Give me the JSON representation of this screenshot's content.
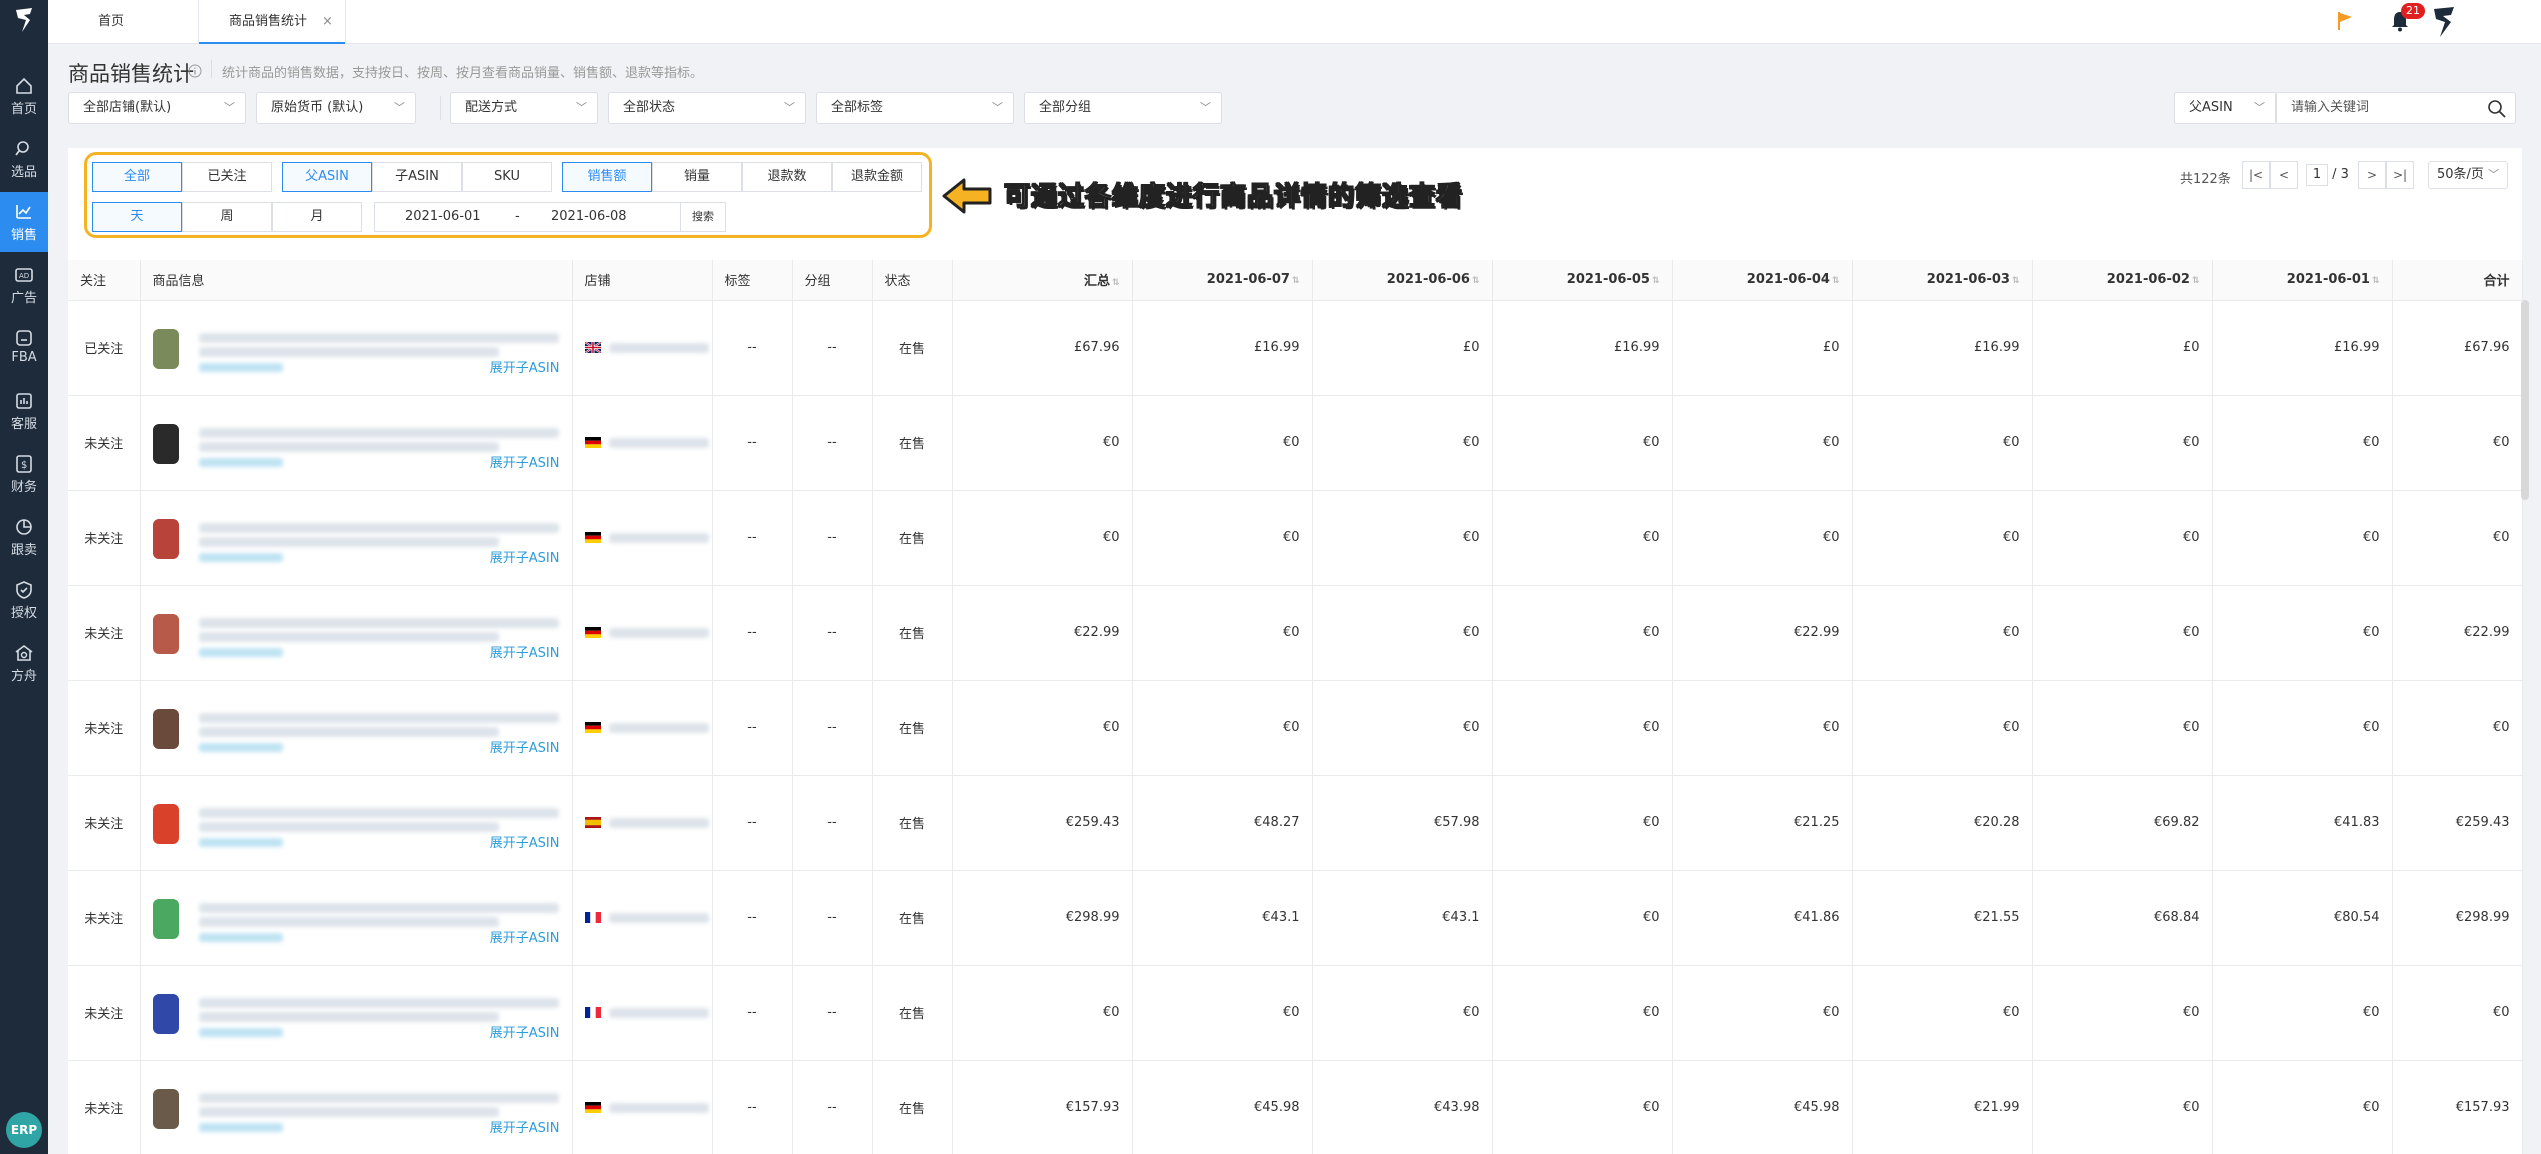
{
  "nav": {
    "items": [
      {
        "label": "首页",
        "icon": "home-icon"
      },
      {
        "label": "选品",
        "icon": "search-icon"
      },
      {
        "label": "销售",
        "icon": "chart-icon"
      },
      {
        "label": "广告",
        "icon": "ad-icon"
      },
      {
        "label": "FBA",
        "icon": "warehouse-icon"
      },
      {
        "label": "客服",
        "icon": "service-icon"
      },
      {
        "label": "财务",
        "icon": "finance-icon"
      },
      {
        "label": "跟卖",
        "icon": "pie-icon"
      },
      {
        "label": "授权",
        "icon": "shield-icon"
      },
      {
        "label": "方舟",
        "icon": "ark-icon"
      }
    ],
    "active": "销售",
    "erp_label": "ERP"
  },
  "tabs": {
    "home": "首页",
    "current": "商品销售统计",
    "close": "×"
  },
  "header": {
    "notifications": "21",
    "title": "商品销售统计",
    "description": "统计商品的销售数据，支持按日、按周、按月查看商品销量、销售额、退款等指标。"
  },
  "filters": {
    "store": "全部店铺(默认)",
    "currency": "原始货币 (默认)",
    "shipping": "配送方式",
    "status": "全部状态",
    "tag": "全部标签",
    "group": "全部分组",
    "search_type": "父ASIN",
    "search_placeholder": "请输入关键词"
  },
  "toolbar": {
    "scope": [
      "全部",
      "已关注"
    ],
    "asin_type": [
      "父ASIN",
      "子ASIN",
      "SKU"
    ],
    "metric": [
      "销售额",
      "销量",
      "退款数",
      "退款金额"
    ],
    "granularity": [
      "天",
      "周",
      "月"
    ],
    "date_start": "2021-06-01",
    "date_sep": "-",
    "date_end": "2021-06-08",
    "search_btn": "搜索",
    "annotation": "可通过各维度进行商品详情的筛选查看"
  },
  "pagination": {
    "total": "共122条",
    "first": "|<",
    "prev": "<",
    "current": "1",
    "pages": "/ 3",
    "next": ">",
    "last": ">|",
    "page_size": "50条/页"
  },
  "table": {
    "headers": [
      "关注",
      "商品信息",
      "店铺",
      "标签",
      "分组",
      "状态",
      "汇总",
      "2021-06-07",
      "2021-06-06",
      "2021-06-05",
      "2021-06-04",
      "2021-06-03",
      "2021-06-02",
      "2021-06-01",
      "合计"
    ],
    "expand_label": "展开子ASIN",
    "rows": [
      {
        "follow": "已关注",
        "flag": "uk",
        "tag": "--",
        "group": "--",
        "status": "在售",
        "values": [
          "£67.96",
          "£16.99",
          "£0",
          "£16.99",
          "£0",
          "£16.99",
          "£0",
          "£16.99",
          "£67.96"
        ],
        "thumb": "#7a8a5a"
      },
      {
        "follow": "未关注",
        "flag": "de",
        "tag": "--",
        "group": "--",
        "status": "在售",
        "values": [
          "€0",
          "€0",
          "€0",
          "€0",
          "€0",
          "€0",
          "€0",
          "€0",
          "€0"
        ],
        "thumb": "#2a2a2a"
      },
      {
        "follow": "未关注",
        "flag": "de",
        "tag": "--",
        "group": "--",
        "status": "在售",
        "values": [
          "€0",
          "€0",
          "€0",
          "€0",
          "€0",
          "€0",
          "€0",
          "€0",
          "€0"
        ],
        "thumb": "#b8433a"
      },
      {
        "follow": "未关注",
        "flag": "de",
        "tag": "--",
        "group": "--",
        "status": "在售",
        "values": [
          "€22.99",
          "€0",
          "€0",
          "€0",
          "€22.99",
          "€0",
          "€0",
          "€0",
          "€22.99"
        ],
        "thumb": "#b85a4a"
      },
      {
        "follow": "未关注",
        "flag": "de",
        "tag": "--",
        "group": "--",
        "status": "在售",
        "values": [
          "€0",
          "€0",
          "€0",
          "€0",
          "€0",
          "€0",
          "€0",
          "€0",
          "€0"
        ],
        "thumb": "#6a4a3a"
      },
      {
        "follow": "未关注",
        "flag": "es",
        "tag": "--",
        "group": "--",
        "status": "在售",
        "values": [
          "€259.43",
          "€48.27",
          "€57.98",
          "€0",
          "€21.25",
          "€20.28",
          "€69.82",
          "€41.83",
          "€259.43"
        ],
        "thumb": "#d9412b"
      },
      {
        "follow": "未关注",
        "flag": "fr",
        "tag": "--",
        "group": "--",
        "status": "在售",
        "values": [
          "€298.99",
          "€43.1",
          "€43.1",
          "€0",
          "€41.86",
          "€21.55",
          "€68.84",
          "€80.54",
          "€298.99"
        ],
        "thumb": "#4aa860"
      },
      {
        "follow": "未关注",
        "flag": "fr",
        "tag": "--",
        "group": "--",
        "status": "在售",
        "values": [
          "€0",
          "€0",
          "€0",
          "€0",
          "€0",
          "€0",
          "€0",
          "€0",
          "€0"
        ],
        "thumb": "#3048a8"
      },
      {
        "follow": "未关注",
        "flag": "de",
        "tag": "--",
        "group": "--",
        "status": "在售",
        "values": [
          "€157.93",
          "€45.98",
          "€43.98",
          "€0",
          "€45.98",
          "€21.99",
          "€0",
          "€0",
          "€157.93"
        ],
        "thumb": "#6a5a4a"
      }
    ]
  },
  "colors": {
    "accent": "#2d8cf0",
    "sidebar": "#1d2b3a",
    "highlight": "#f5b324"
  }
}
